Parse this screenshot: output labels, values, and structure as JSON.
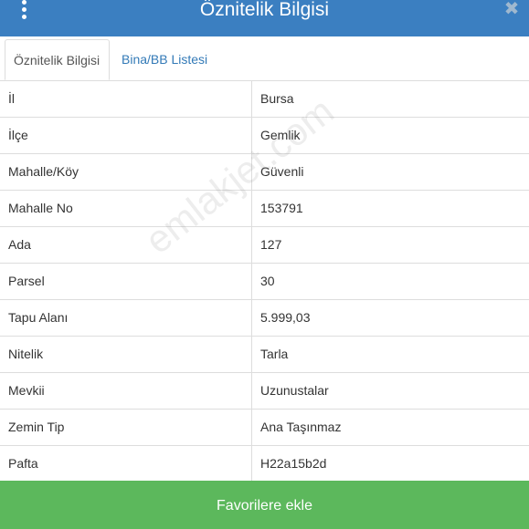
{
  "header": {
    "title": "Öznitelik Bilgisi",
    "close_glyph": "✖",
    "menu_icon": "vertical-dots-icon",
    "close_icon": "close-icon"
  },
  "tabs": [
    {
      "label": "Öznitelik Bilgisi",
      "active": true
    },
    {
      "label": "Bina/BB Listesi",
      "active": false
    }
  ],
  "rows": [
    {
      "key": "İl",
      "value": "Bursa"
    },
    {
      "key": "İlçe",
      "value": "Gemlik"
    },
    {
      "key": "Mahalle/Köy",
      "value": "Güvenli"
    },
    {
      "key": "Mahalle No",
      "value": "153791"
    },
    {
      "key": "Ada",
      "value": "127"
    },
    {
      "key": "Parsel",
      "value": "30"
    },
    {
      "key": "Tapu Alanı",
      "value": "5.999,03"
    },
    {
      "key": "Nitelik",
      "value": "Tarla"
    },
    {
      "key": "Mevkii",
      "value": "Uzunustalar"
    },
    {
      "key": "Zemin Tip",
      "value": "Ana Taşınmaz"
    },
    {
      "key": "Pafta",
      "value": "H22a15b2d"
    }
  ],
  "footer": {
    "button_label": "Favorilere ekle"
  },
  "watermark": "emlakjet.com",
  "colors": {
    "header_bg": "#3b7fc1",
    "footer_bg": "#5cb85c",
    "link": "#337ab7"
  }
}
